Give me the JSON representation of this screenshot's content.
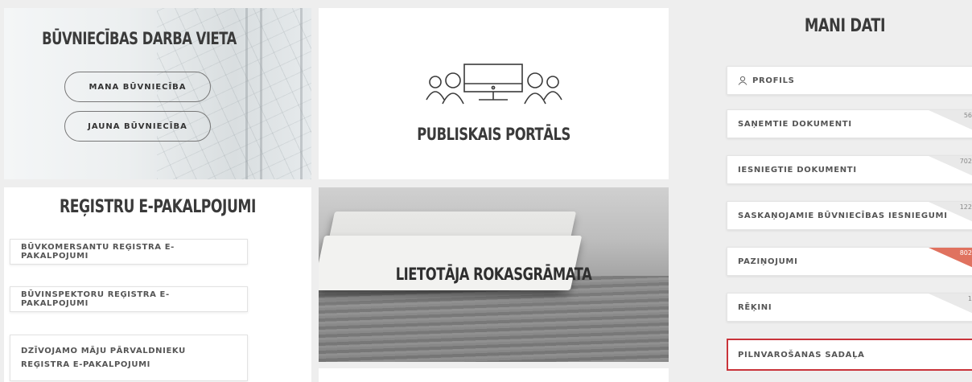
{
  "work_tile": {
    "title": "BŪVNIECĪBAS DARBA VIETA",
    "my_construction": "MANA BŪVNIECĪBA",
    "new_construction": "JAUNA BŪVNIECĪBA"
  },
  "portal_tile": {
    "title": "PUBLISKAIS PORTĀLS",
    "icon": "people-monitor-icon"
  },
  "registry_tile": {
    "title": "REĢISTRU E-PAKALPOJUMI",
    "items": [
      "BŪVKOMERSANTU REĢISTRA E-PAKALPOJUMI",
      "BŪVINSPEKTORU REĢISTRA E-PAKALPOJUMI",
      "DZĪVOJAMO MĀJU PĀRVALDNIEKU REĢISTRA E-PAKALPOJUMI"
    ]
  },
  "manual_tile": {
    "title": "LIETOTĀJA ROKASGRĀMATA"
  },
  "my_data": {
    "title": "MANI DATI",
    "items": [
      {
        "label": "PROFILS",
        "icon": "user-icon"
      },
      {
        "label": "SAŅEMTIE DOKUMENTI",
        "count": "56"
      },
      {
        "label": "IESNIEGTIE DOKUMENTI",
        "count": "702"
      },
      {
        "label": "SASKAŅOJAMIE BŪVNIECĪBAS IESNIEGUMI",
        "count": "122"
      },
      {
        "label": "PAZIŅOJUMI",
        "count": "802",
        "highlight": "#e0725f"
      },
      {
        "label": "RĒĶINI",
        "count": "1"
      },
      {
        "label": "PILNVAROŠANAS SADAĻA",
        "selected_border": "#c9333a"
      }
    ]
  }
}
